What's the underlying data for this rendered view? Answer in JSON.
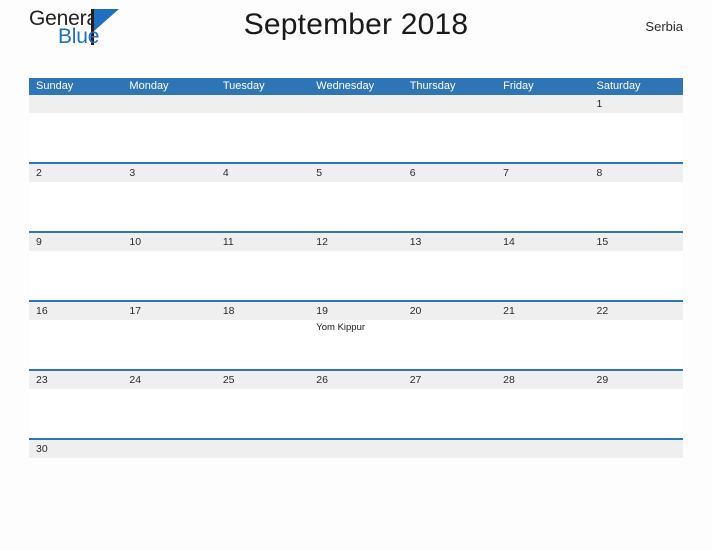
{
  "logo": {
    "word_one": "General",
    "word_two": "Blue",
    "mark": "triangle-flag-icon"
  },
  "header": {
    "title": "September 2018",
    "country": "Serbia"
  },
  "calendar": {
    "day_headers": [
      "Sunday",
      "Monday",
      "Tuesday",
      "Wednesday",
      "Thursday",
      "Friday",
      "Saturday"
    ],
    "colors": {
      "header_blue": "#2e75b6",
      "row_divider_blue": "#2e75b6",
      "date_band_gray": "#efefef",
      "logo_blue": "#1f6fbf",
      "text_dark": "#231f20",
      "page_background": "#fdfdfd"
    },
    "weeks": [
      [
        {
          "date": "",
          "event": ""
        },
        {
          "date": "",
          "event": ""
        },
        {
          "date": "",
          "event": ""
        },
        {
          "date": "",
          "event": ""
        },
        {
          "date": "",
          "event": ""
        },
        {
          "date": "",
          "event": ""
        },
        {
          "date": "1",
          "event": ""
        }
      ],
      [
        {
          "date": "2",
          "event": ""
        },
        {
          "date": "3",
          "event": ""
        },
        {
          "date": "4",
          "event": ""
        },
        {
          "date": "5",
          "event": ""
        },
        {
          "date": "6",
          "event": ""
        },
        {
          "date": "7",
          "event": ""
        },
        {
          "date": "8",
          "event": ""
        }
      ],
      [
        {
          "date": "9",
          "event": ""
        },
        {
          "date": "10",
          "event": ""
        },
        {
          "date": "11",
          "event": ""
        },
        {
          "date": "12",
          "event": ""
        },
        {
          "date": "13",
          "event": ""
        },
        {
          "date": "14",
          "event": ""
        },
        {
          "date": "15",
          "event": ""
        }
      ],
      [
        {
          "date": "16",
          "event": ""
        },
        {
          "date": "17",
          "event": ""
        },
        {
          "date": "18",
          "event": ""
        },
        {
          "date": "19",
          "event": "Yom Kippur"
        },
        {
          "date": "20",
          "event": ""
        },
        {
          "date": "21",
          "event": ""
        },
        {
          "date": "22",
          "event": ""
        }
      ],
      [
        {
          "date": "23",
          "event": ""
        },
        {
          "date": "24",
          "event": ""
        },
        {
          "date": "25",
          "event": ""
        },
        {
          "date": "26",
          "event": ""
        },
        {
          "date": "27",
          "event": ""
        },
        {
          "date": "28",
          "event": ""
        },
        {
          "date": "29",
          "event": ""
        }
      ],
      [
        {
          "date": "30",
          "event": ""
        },
        {
          "date": "",
          "event": ""
        },
        {
          "date": "",
          "event": ""
        },
        {
          "date": "",
          "event": ""
        },
        {
          "date": "",
          "event": ""
        },
        {
          "date": "",
          "event": ""
        },
        {
          "date": "",
          "event": ""
        }
      ]
    ]
  }
}
